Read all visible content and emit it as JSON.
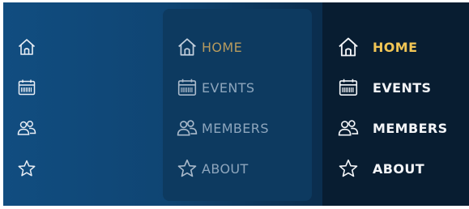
{
  "colors": {
    "icon_collapsed": "#e9eef5",
    "icon_hover": "#b8c6d5",
    "icon_active": "#f3f5f8",
    "label_hover": "#8ea6bd",
    "label_hover_active": "#b69a5e",
    "label_active": "#f3f5f8",
    "label_active_accent": "#f2c655"
  },
  "nav": {
    "items": [
      {
        "key": "home",
        "label": "HOME",
        "icon": "home-icon"
      },
      {
        "key": "events",
        "label": "EVENTS",
        "icon": "calendar-icon"
      },
      {
        "key": "members",
        "label": "MEMBERS",
        "icon": "users-icon"
      },
      {
        "key": "about",
        "label": "ABOUT",
        "icon": "star-icon"
      }
    ],
    "active_item": "home"
  }
}
